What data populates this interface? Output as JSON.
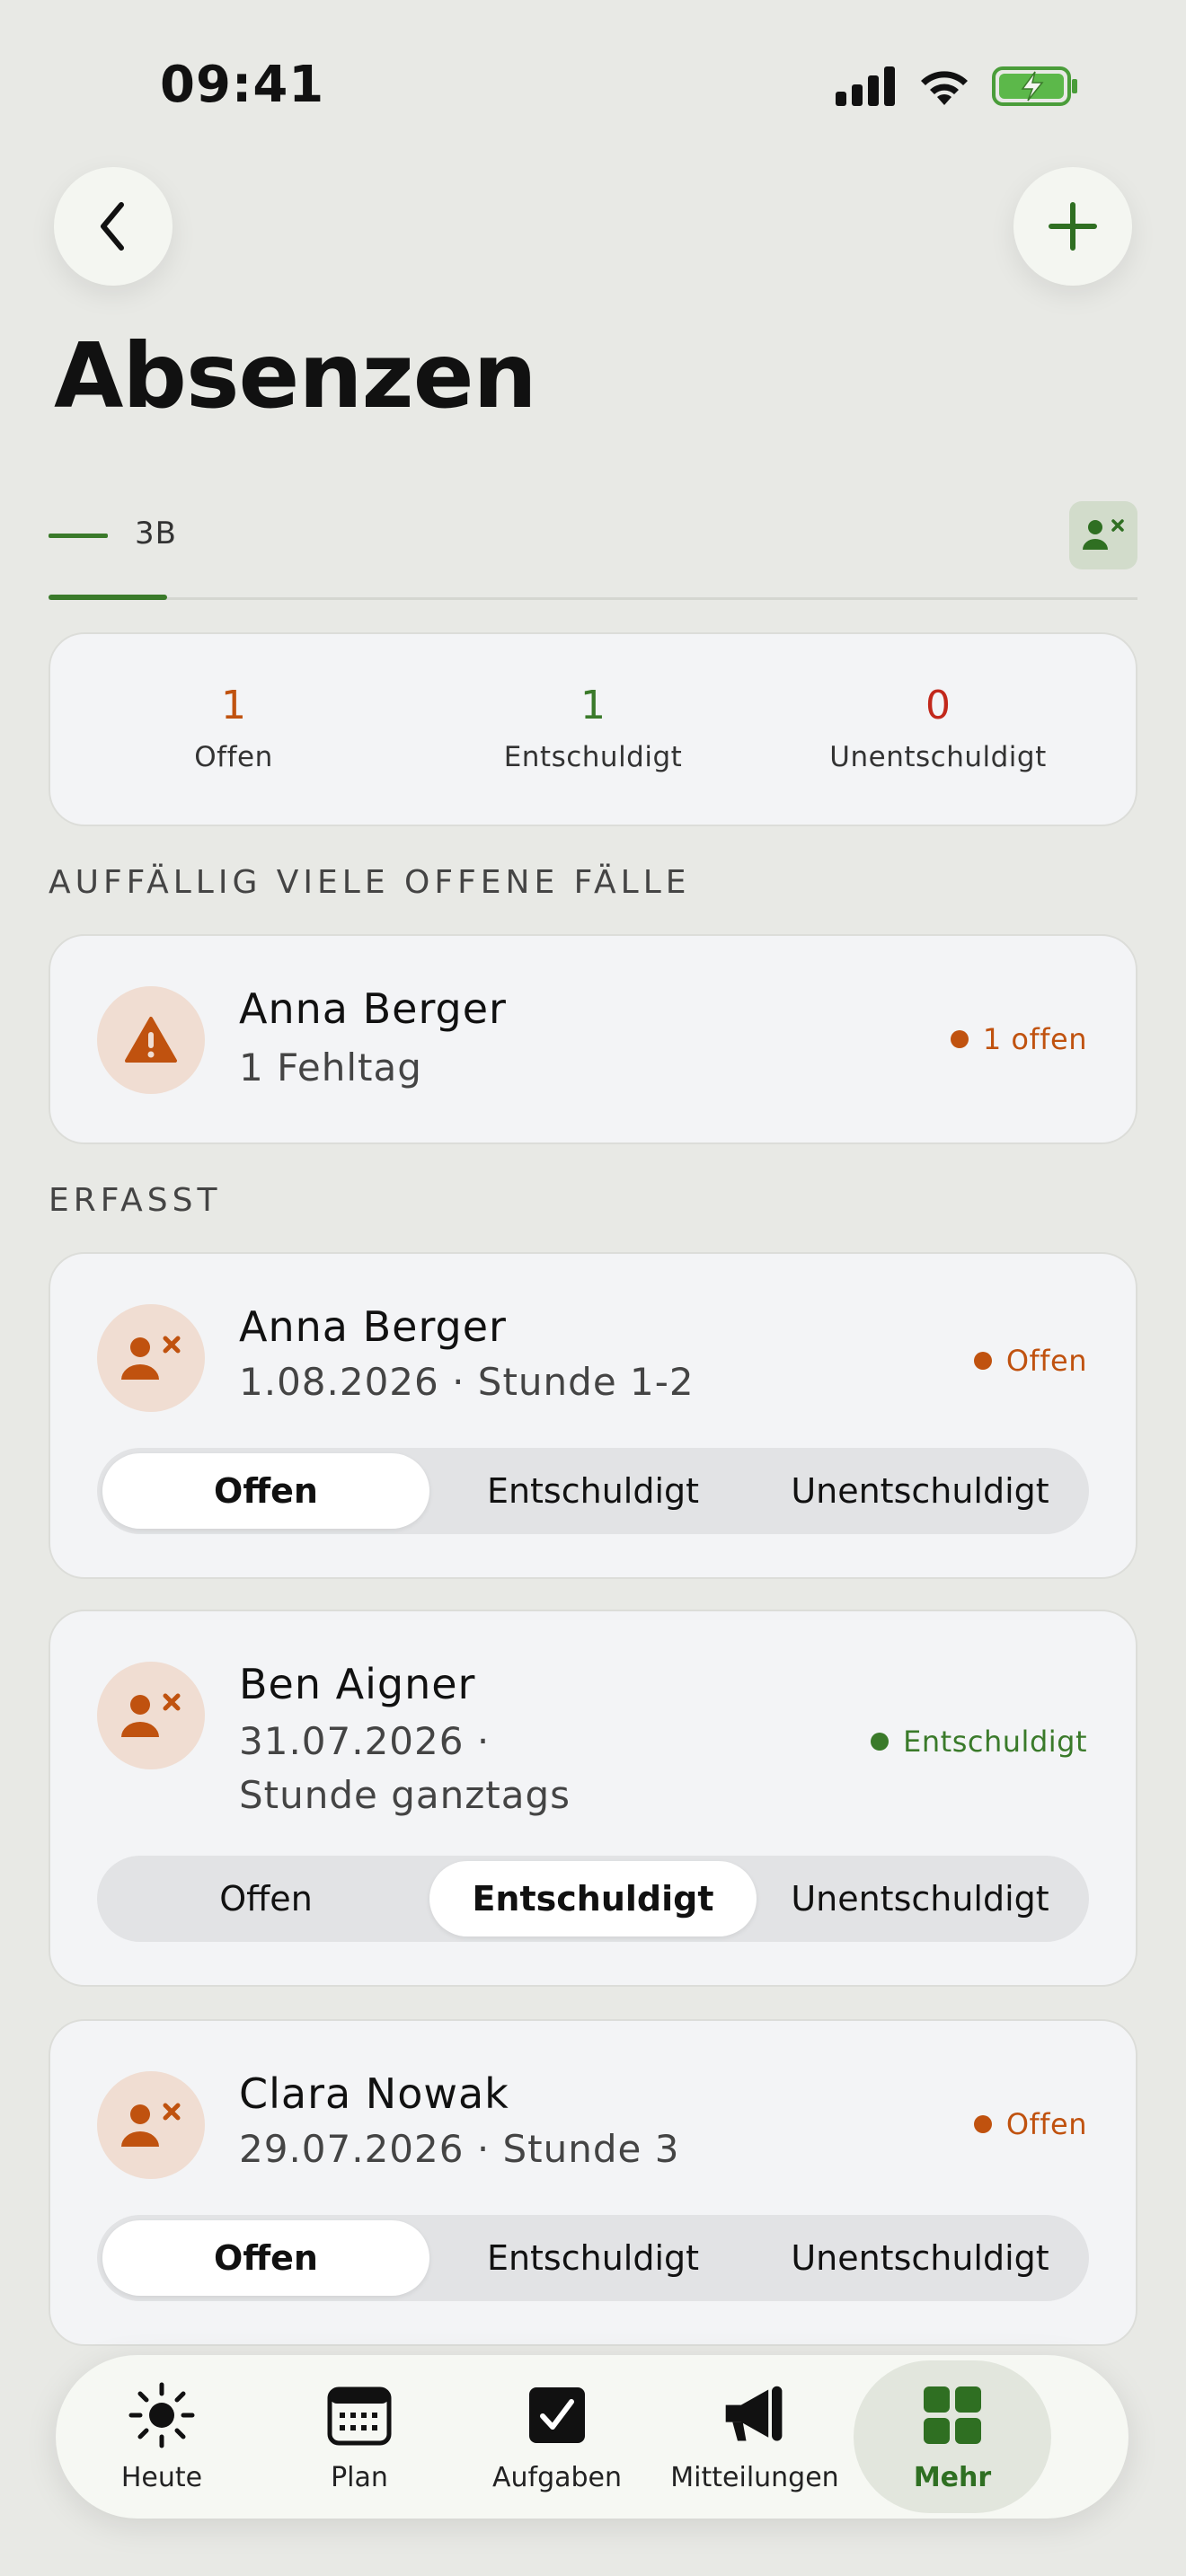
{
  "status_bar": {
    "time": "09:41"
  },
  "header": {
    "title": "Absenzen"
  },
  "tabs": [
    {
      "label": "3B"
    }
  ],
  "summary": {
    "open": {
      "value": "1",
      "label": "Offen"
    },
    "excused": {
      "value": "1",
      "label": "Entschuldigt"
    },
    "unexcused": {
      "value": "0",
      "label": "Unentschuldigt"
    }
  },
  "sections": {
    "flagged": "AUFFÄLLIG VIELE OFFENE FÄLLE",
    "recorded": "ERFASST"
  },
  "flagged_case": {
    "name": "Anna Berger",
    "subtitle": "1 Fehltag",
    "badge": "1 offen"
  },
  "absences": [
    {
      "name": "Anna Berger",
      "line1": "1.08.2026 · Stunde 1-2",
      "line2": "",
      "status": "Offen",
      "selected": "Offen"
    },
    {
      "name": "Ben Aigner",
      "line1": "31.07.2026 ·",
      "line2": "Stunde ganztags",
      "status": "Entschuldigt",
      "selected": "Entschuldigt"
    },
    {
      "name": "Clara Nowak",
      "line1": "29.07.2026 · Stunde 3",
      "line2": "",
      "status": "Offen",
      "selected": "Offen"
    }
  ],
  "segment_options": [
    "Offen",
    "Entschuldigt",
    "Unentschuldigt"
  ],
  "bottom_nav": [
    {
      "label": "Heute",
      "icon": "sun-icon"
    },
    {
      "label": "Plan",
      "icon": "calendar-icon"
    },
    {
      "label": "Aufgaben",
      "icon": "checkbox-icon"
    },
    {
      "label": "Mitteilungen",
      "icon": "megaphone-icon"
    },
    {
      "label": "Mehr",
      "icon": "grid-icon",
      "active": true
    }
  ],
  "colors": {
    "accent_green": "#3a7a2a",
    "open_orange": "#c0520f",
    "unexcused_red": "#c2281b",
    "background": "#e8e9e5"
  }
}
